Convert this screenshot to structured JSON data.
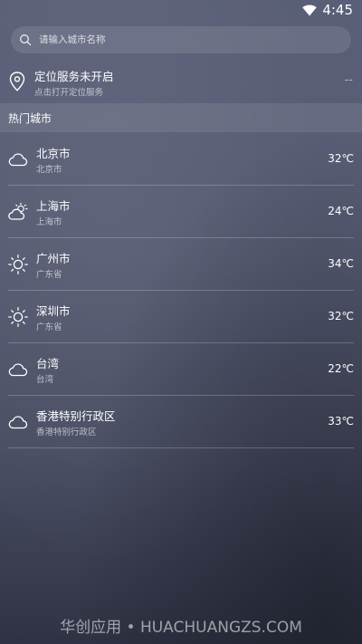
{
  "status_bar": {
    "time": "4:45",
    "icons": [
      "wifi-icon"
    ]
  },
  "search": {
    "placeholder": "请输入城市名称",
    "icon": "search-icon"
  },
  "location": {
    "title": "定位服务未开启",
    "subtitle": "点击打开定位服务",
    "value": "--",
    "icon": "location-pin-icon"
  },
  "hot_cities": {
    "title": "热门城市",
    "items": [
      {
        "name": "北京市",
        "region": "北京市",
        "temp": "32℃",
        "icon": "cloudy-icon"
      },
      {
        "name": "上海市",
        "region": "上海市",
        "temp": "24℃",
        "icon": "partly-cloudy-icon"
      },
      {
        "name": "广州市",
        "region": "广东省",
        "temp": "34℃",
        "icon": "sunny-icon"
      },
      {
        "name": "深圳市",
        "region": "广东省",
        "temp": "32℃",
        "icon": "sunny-icon"
      },
      {
        "name": "台湾",
        "region": "台湾",
        "temp": "22℃",
        "icon": "cloudy-icon"
      },
      {
        "name": "香港特别行政区",
        "region": "香港特别行政区",
        "temp": "33℃",
        "icon": "cloudy-icon"
      }
    ]
  },
  "watermark": {
    "text": "华创应用 • HUACHUANGZS.COM"
  },
  "colors": {
    "background_top": "#5a5f78",
    "background_bottom": "#2f3243",
    "text": "#ffffff"
  }
}
